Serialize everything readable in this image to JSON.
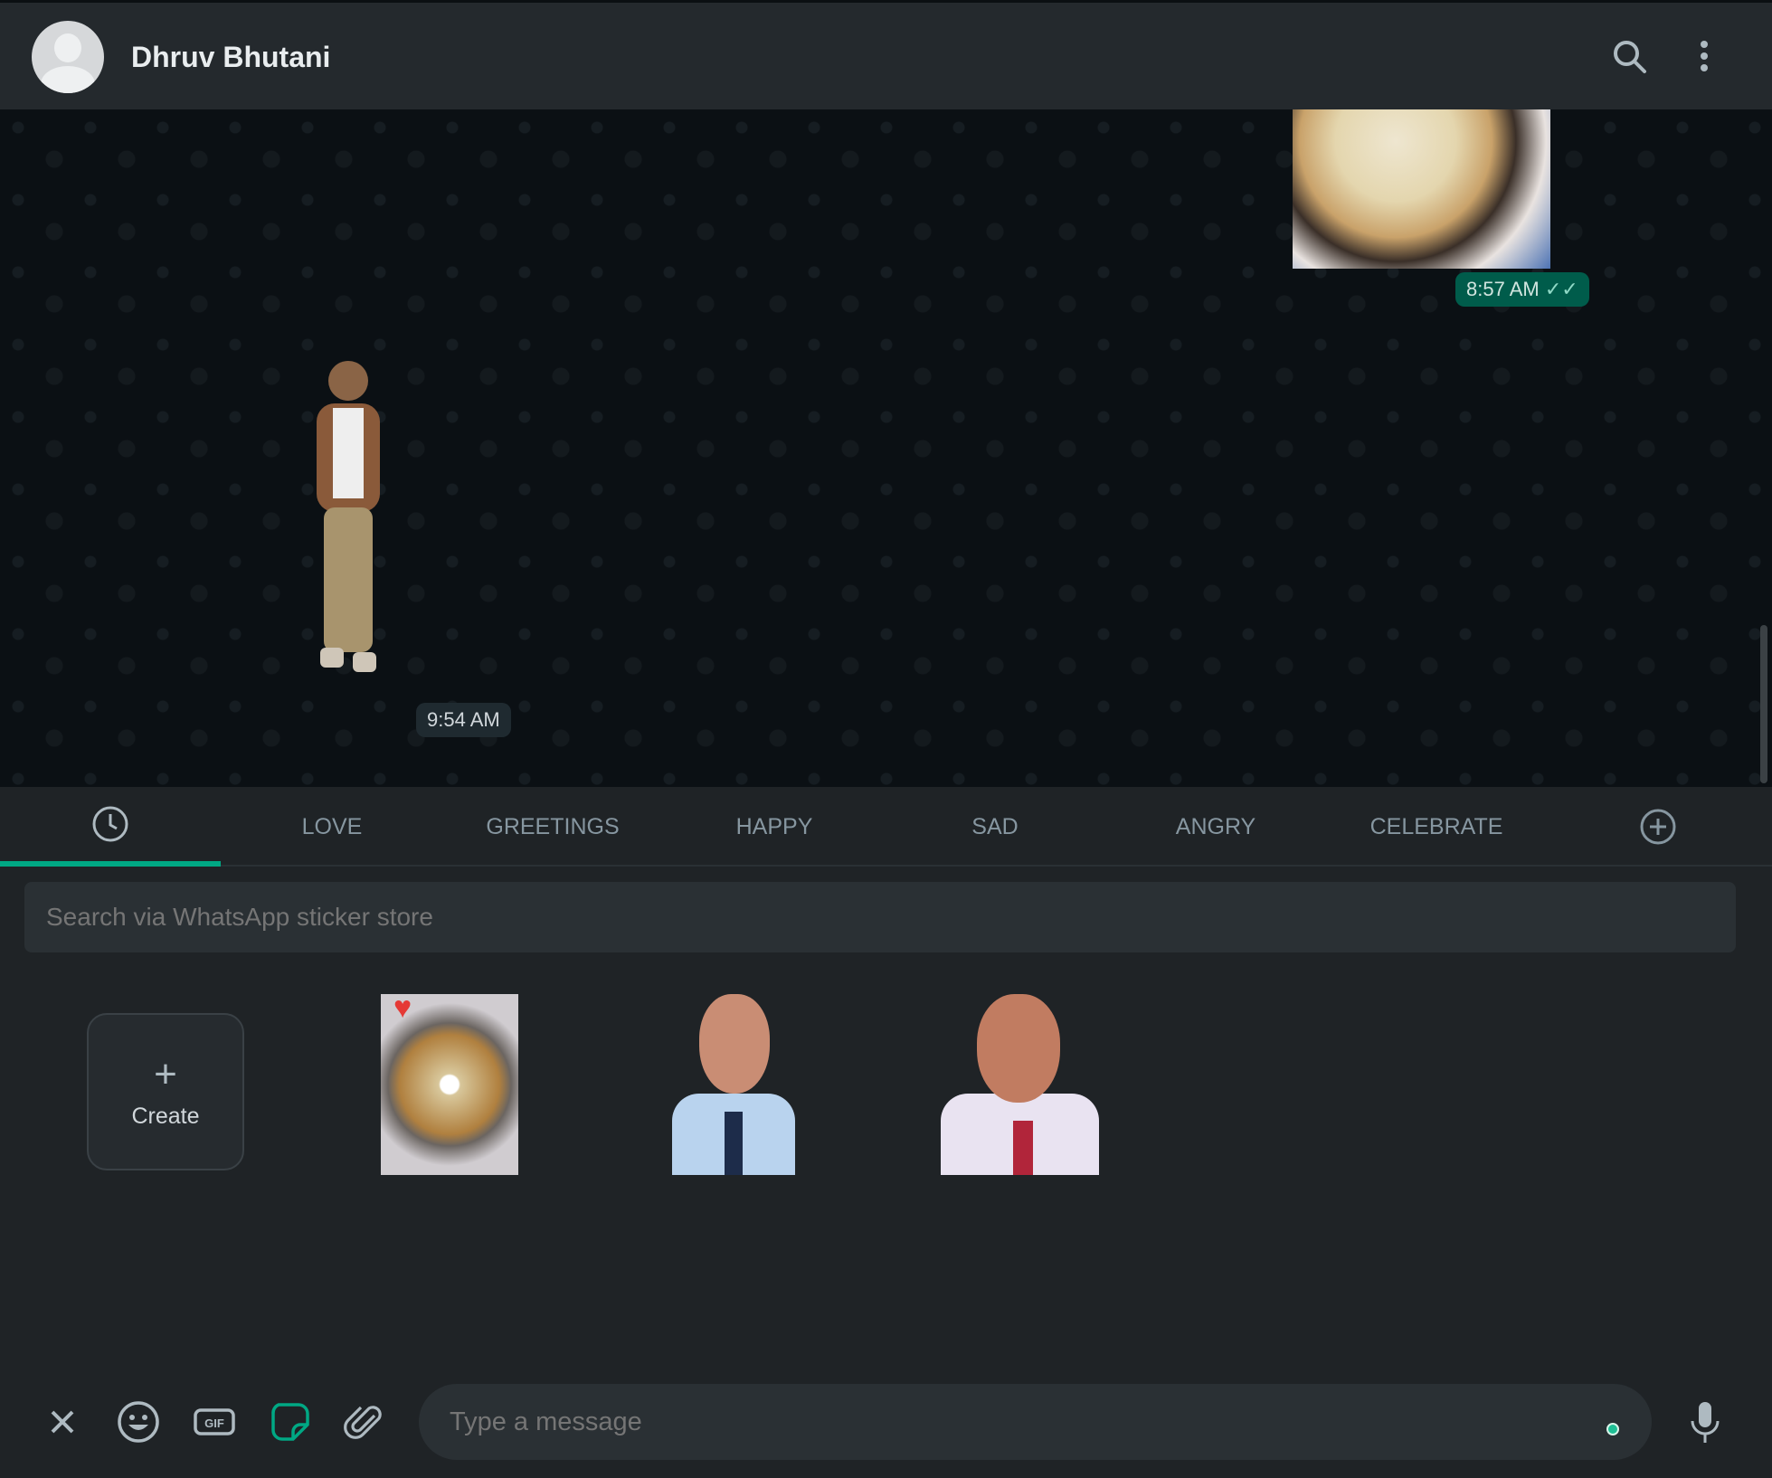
{
  "header": {
    "contact_name": "Dhruv Bhutani",
    "icons": [
      "avatar",
      "search-icon",
      "menu-icon"
    ]
  },
  "messages": [
    {
      "type": "image",
      "direction": "outgoing",
      "time": "8:57 AM",
      "status": "read"
    },
    {
      "type": "sticker",
      "direction": "incoming",
      "time": "9:54 AM"
    }
  ],
  "sticker_panel": {
    "tabs": [
      {
        "icon": "clock-icon",
        "label": ""
      },
      {
        "label": "LOVE"
      },
      {
        "label": "GREETINGS"
      },
      {
        "label": "HAPPY"
      },
      {
        "label": "SAD"
      },
      {
        "label": "ANGRY"
      },
      {
        "label": "CELEBRATE"
      },
      {
        "icon": "add-icon",
        "label": ""
      }
    ],
    "active_tab": 0,
    "search_placeholder": "Search via WhatsApp sticker store",
    "create_label": "Create",
    "stickers": [
      "pizza-sticker",
      "man-tie-sticker",
      "man-smiling-sticker"
    ]
  },
  "composer": {
    "placeholder": "Type a message",
    "icons": [
      "close-icon",
      "emoji-icon",
      "gif-icon",
      "sticker-icon",
      "attach-icon",
      "mic-icon"
    ]
  },
  "colors": {
    "accent": "#00a884",
    "outgoing_bubble": "#005c4b",
    "background": "#1f2326"
  }
}
